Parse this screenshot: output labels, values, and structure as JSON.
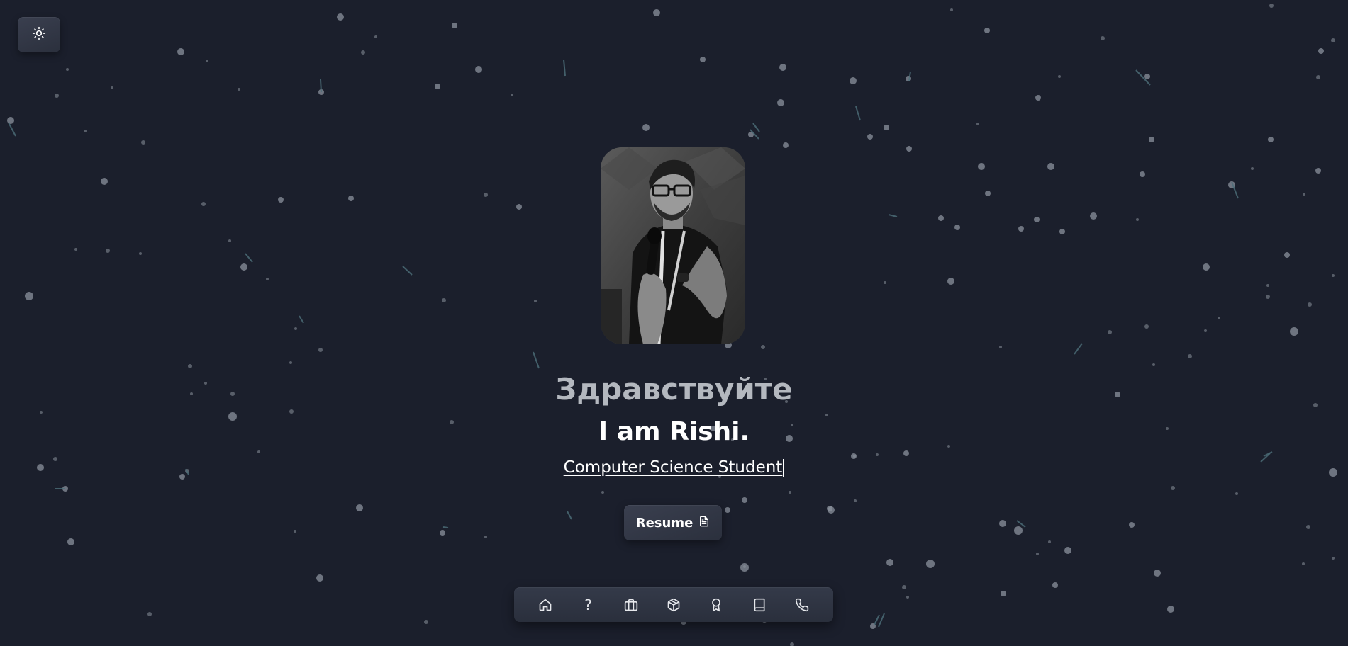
{
  "theme_toggle": {
    "icon": "sun-icon"
  },
  "profile": {
    "photo_alt": "Rishi speaking with a microphone",
    "greeting": "Здравствуйте",
    "intro": "I am Rishi.",
    "role": "Computer Science Student"
  },
  "resume_button": {
    "label": "Resume",
    "icon": "document-icon"
  },
  "dock": {
    "items": [
      {
        "icon": "home-icon"
      },
      {
        "icon": "question-icon",
        "glyph": "?"
      },
      {
        "icon": "briefcase-icon"
      },
      {
        "icon": "package-icon"
      },
      {
        "icon": "award-icon"
      },
      {
        "icon": "book-icon"
      },
      {
        "icon": "phone-icon"
      }
    ]
  },
  "colors": {
    "background": "#1b1f2c",
    "particle": "#8b919c",
    "particle_link": "#4d6f7a",
    "greeting_text": "#b4b8bf"
  }
}
